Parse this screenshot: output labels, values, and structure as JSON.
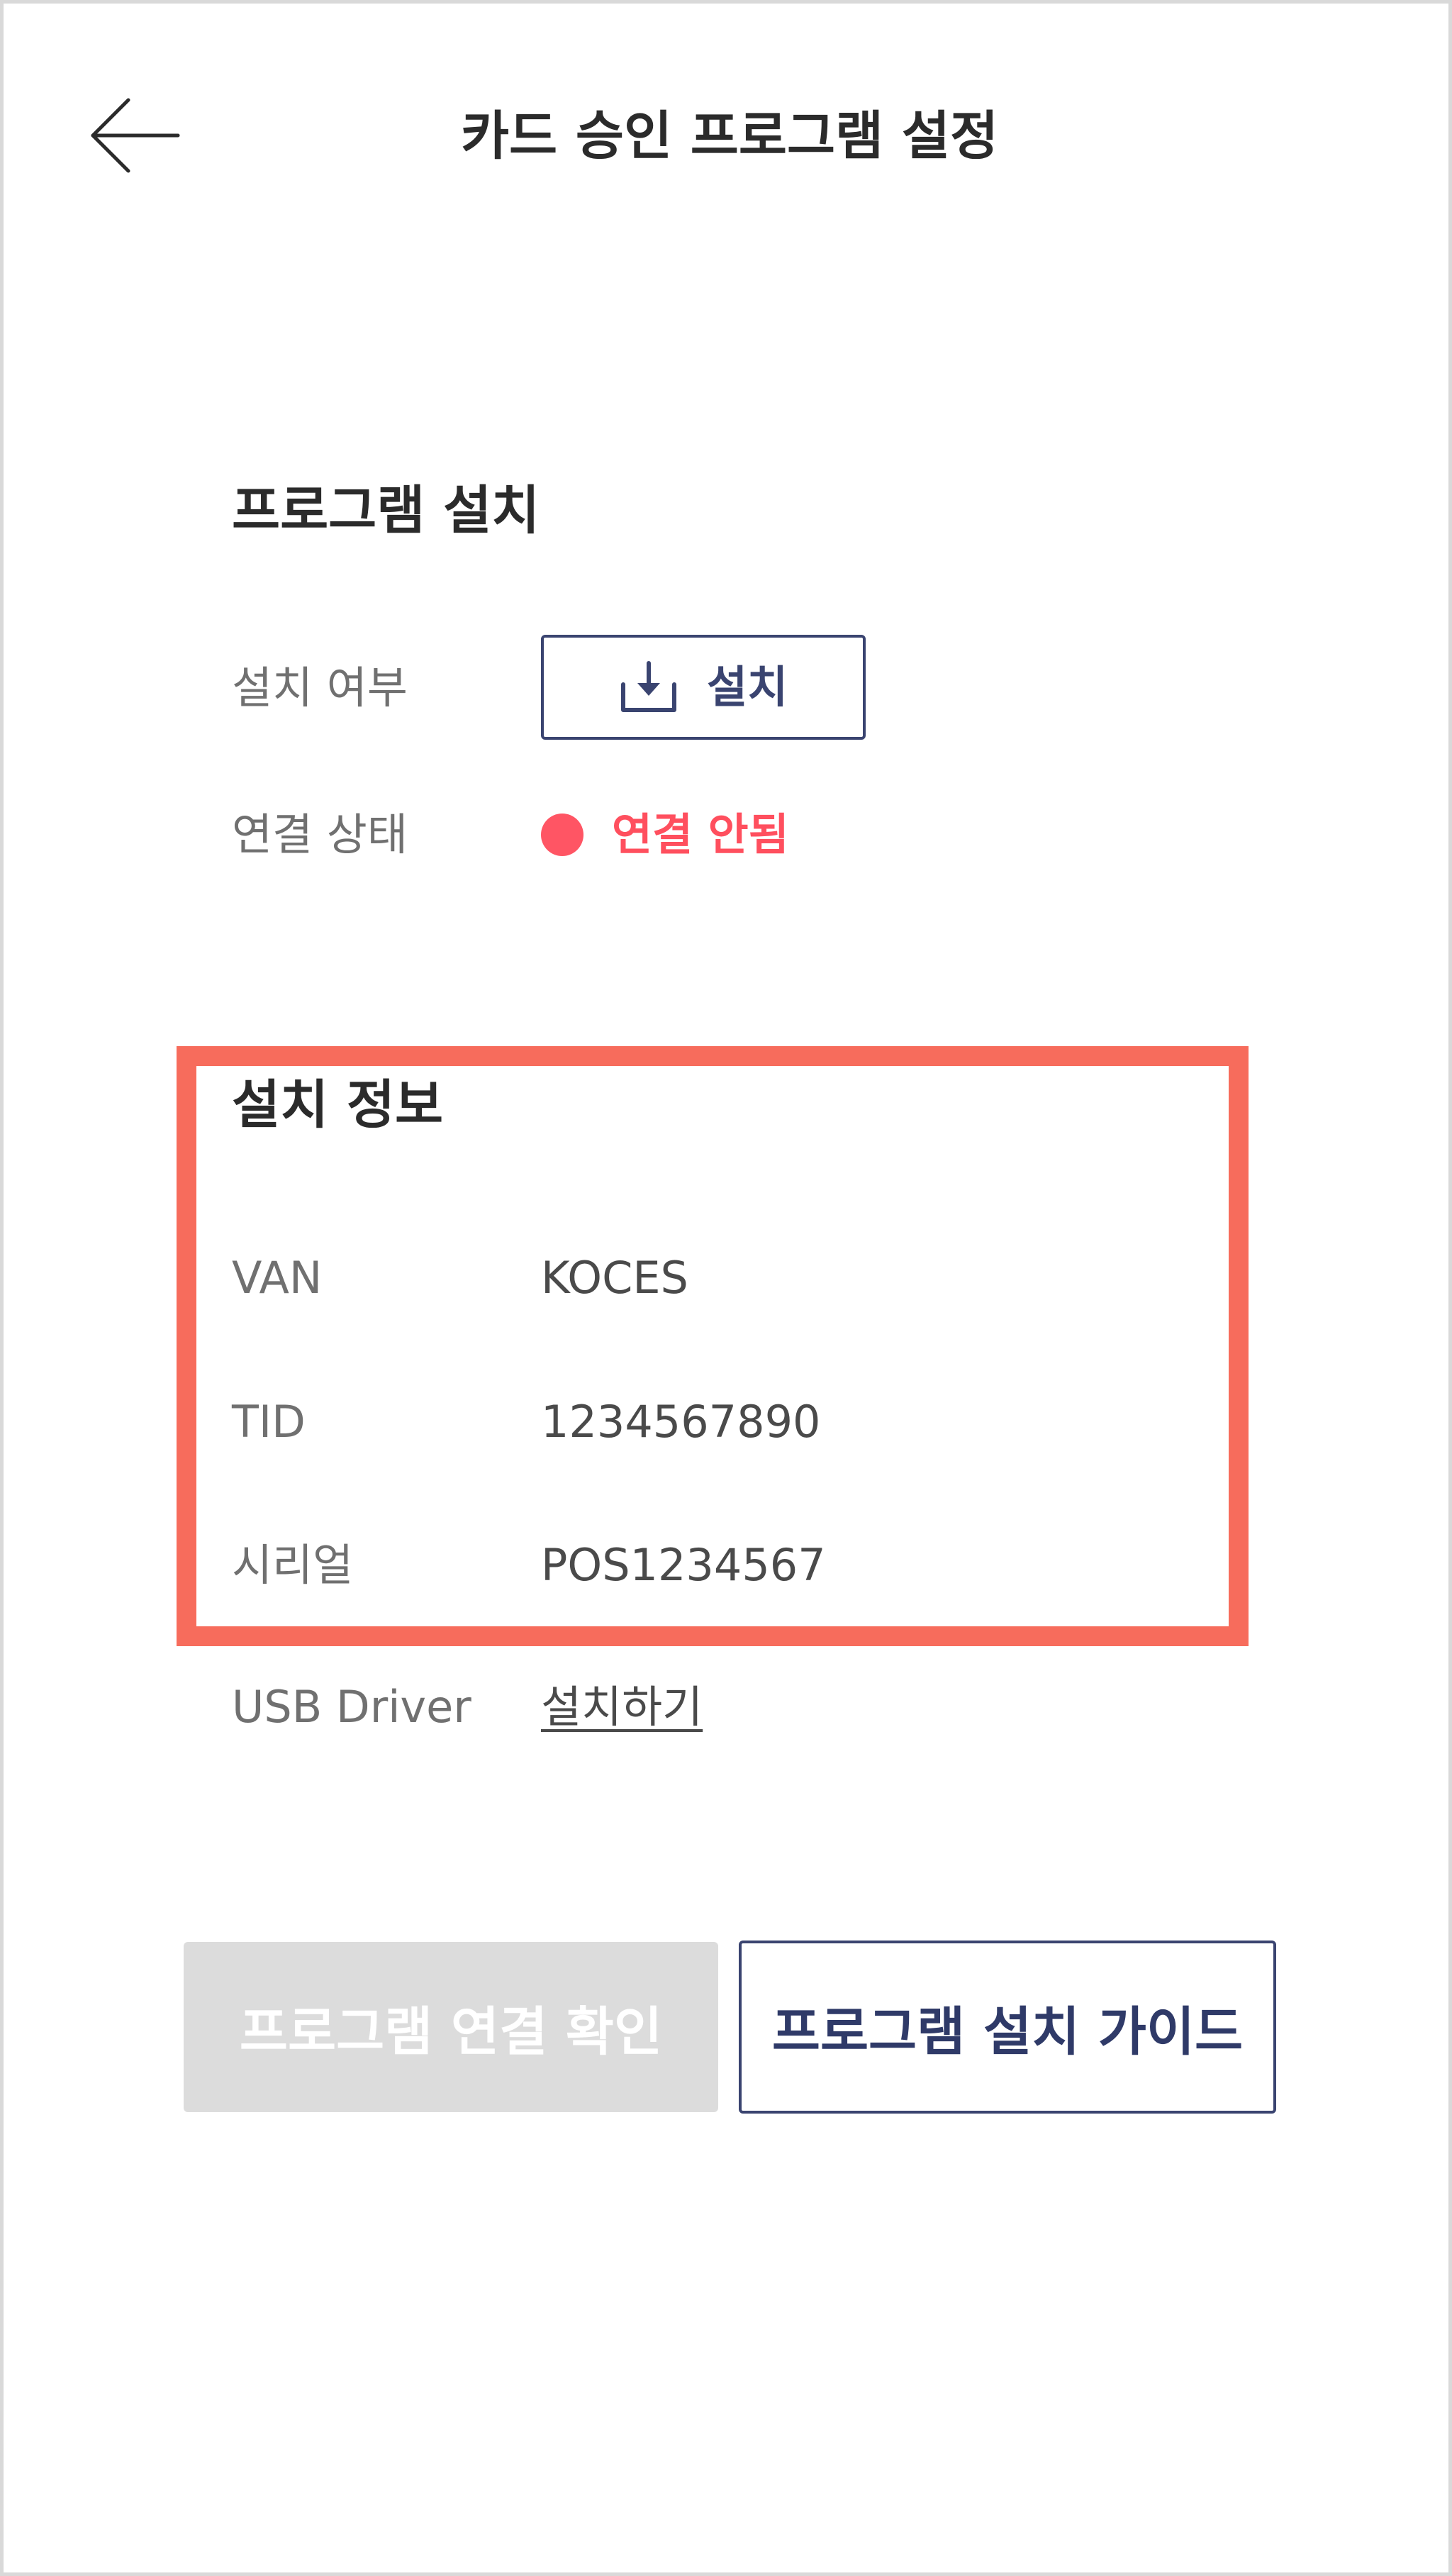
{
  "header": {
    "back_icon": "arrow-left-icon",
    "title": "카드 승인 프로그램 설정"
  },
  "program_install": {
    "section_title": "프로그램 설치",
    "install_status_label": "설치 여부",
    "install_button_label": "설치",
    "install_icon": "download-icon",
    "connection_label": "연결 상태",
    "connection_status": "연결 안됨",
    "connection_status_color": "#ff5564"
  },
  "install_info": {
    "section_title": "설치 정보",
    "rows": [
      {
        "label": "VAN",
        "value": "KOCES"
      },
      {
        "label": "TID",
        "value": "1234567890"
      },
      {
        "label": "시리얼",
        "value": "POS1234567"
      }
    ],
    "highlight_color": "#f76c5c"
  },
  "usb_driver": {
    "label": "USB Driver",
    "link_text": "설치하기"
  },
  "actions": {
    "check_connection_label": "프로그램 연결 확인",
    "install_guide_label": "프로그램 설치 가이드",
    "accent_color": "#3a4470"
  }
}
